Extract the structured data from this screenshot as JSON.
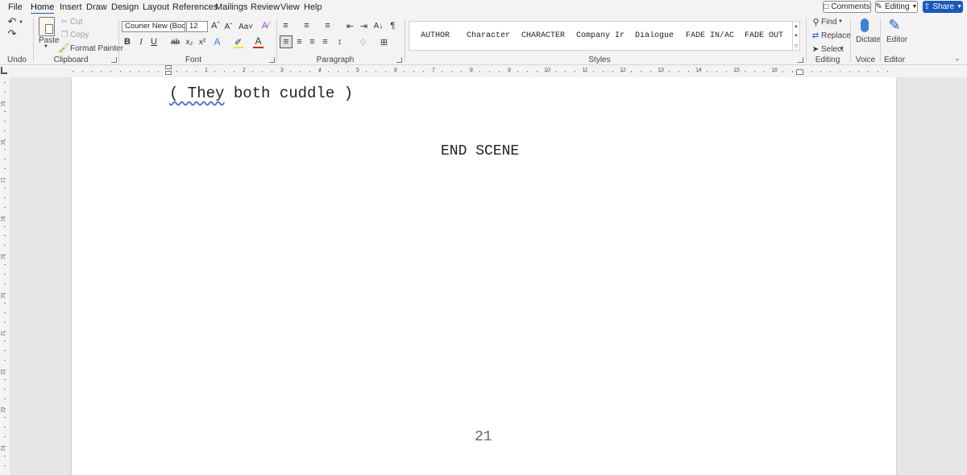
{
  "menu": {
    "tabs": [
      "File",
      "Home",
      "Insert",
      "Draw",
      "Design",
      "Layout",
      "References",
      "Mailings",
      "Review",
      "View",
      "Help"
    ],
    "active": "Home",
    "comments": "Comments",
    "editing": "Editing",
    "share": "Share"
  },
  "ribbon": {
    "undo": {
      "label": "Undo"
    },
    "clipboard": {
      "label": "Clipboard",
      "paste": "Paste",
      "cut": "Cut",
      "copy": "Copy",
      "format_painter": "Format Painter"
    },
    "font": {
      "label": "Font",
      "name": "Courier New (Body)",
      "size": "12"
    },
    "paragraph": {
      "label": "Paragraph"
    },
    "styles": {
      "label": "Styles",
      "items": [
        "AUTHOR",
        "Character",
        "CHARACTER",
        "Company Ir",
        "Dialogue",
        "FADE IN/AC",
        "FADE OUT"
      ]
    },
    "editing": {
      "label": "Editing",
      "find": "Find",
      "replace": "Replace",
      "select": "Select"
    },
    "voice": {
      "label": "Voice",
      "dictate": "Dictate"
    },
    "editor": {
      "label": "Editor",
      "editor": "Editor"
    }
  },
  "ruler": {
    "h_numbers": [
      "1",
      "2",
      "3",
      "4",
      "5",
      "6",
      "7",
      "8",
      "9",
      "10",
      "11",
      "12",
      "13",
      "14",
      "15",
      "16"
    ],
    "v_numbers": [
      "15",
      "16",
      "17",
      "18",
      "19",
      "20",
      "21",
      "22",
      "23",
      "24"
    ]
  },
  "document": {
    "line1_part1": "( They",
    "line1_part2": " both cuddle )",
    "scene_end": "END SCENE",
    "page_number": "21"
  },
  "colors": {
    "accent": "#185abd",
    "squiggle": "#4b72c9"
  }
}
